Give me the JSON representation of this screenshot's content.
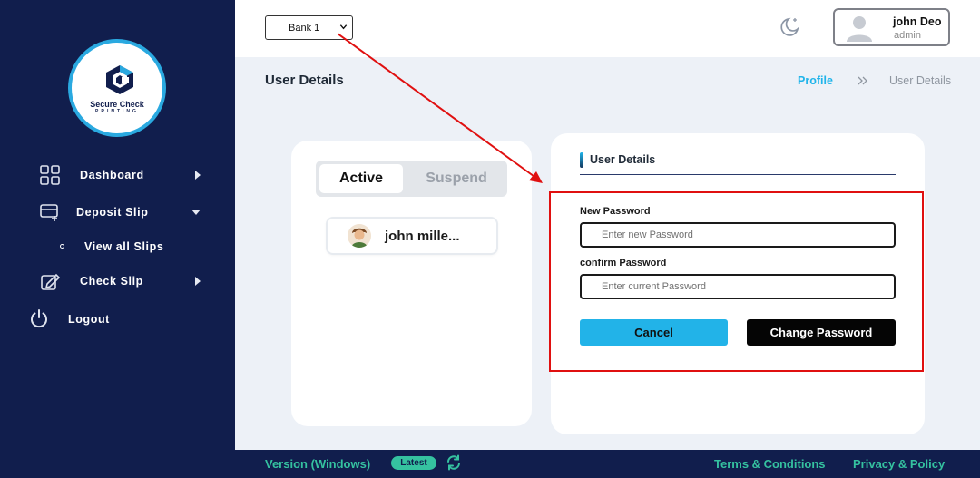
{
  "brand": {
    "line1": "Secure Check",
    "line2": "PRINTING"
  },
  "sidebar": {
    "items": [
      {
        "label": "Dashboard",
        "icon": "grid-icon"
      },
      {
        "label": "Deposit Slip",
        "icon": "deposit-slip-icon"
      },
      {
        "label": "View all Slips",
        "icon": "bullet-icon"
      },
      {
        "label": "Check Slip",
        "icon": "edit-check-icon"
      },
      {
        "label": "Logout",
        "icon": "power-icon"
      }
    ]
  },
  "topbar": {
    "bank_selected": "Bank 1",
    "user_name": "john Deo",
    "user_role": "admin"
  },
  "page": {
    "title": "User Details",
    "breadcrumb": {
      "parent": "Profile",
      "current": "User Details"
    }
  },
  "user_list": {
    "tabs": {
      "active": "Active",
      "suspend": "Suspend"
    },
    "users": [
      {
        "name": "john mille..."
      }
    ]
  },
  "form": {
    "section_title": "User Details",
    "new_password_label": "New Password",
    "new_password_placeholder": "Enter new Password",
    "confirm_password_label": "confirm Password",
    "confirm_password_placeholder": "Enter current Password",
    "cancel_label": "Cancel",
    "submit_label": "Change Password"
  },
  "footer": {
    "version": "Version (Windows)",
    "badge": "Latest",
    "terms": "Terms & Conditions",
    "privacy": "Privacy & Policy"
  },
  "colors": {
    "sidebar_bg": "#111e4d",
    "accent": "#1fb4ea",
    "footer_text": "#35c2a0",
    "annotation": "#e01010"
  }
}
